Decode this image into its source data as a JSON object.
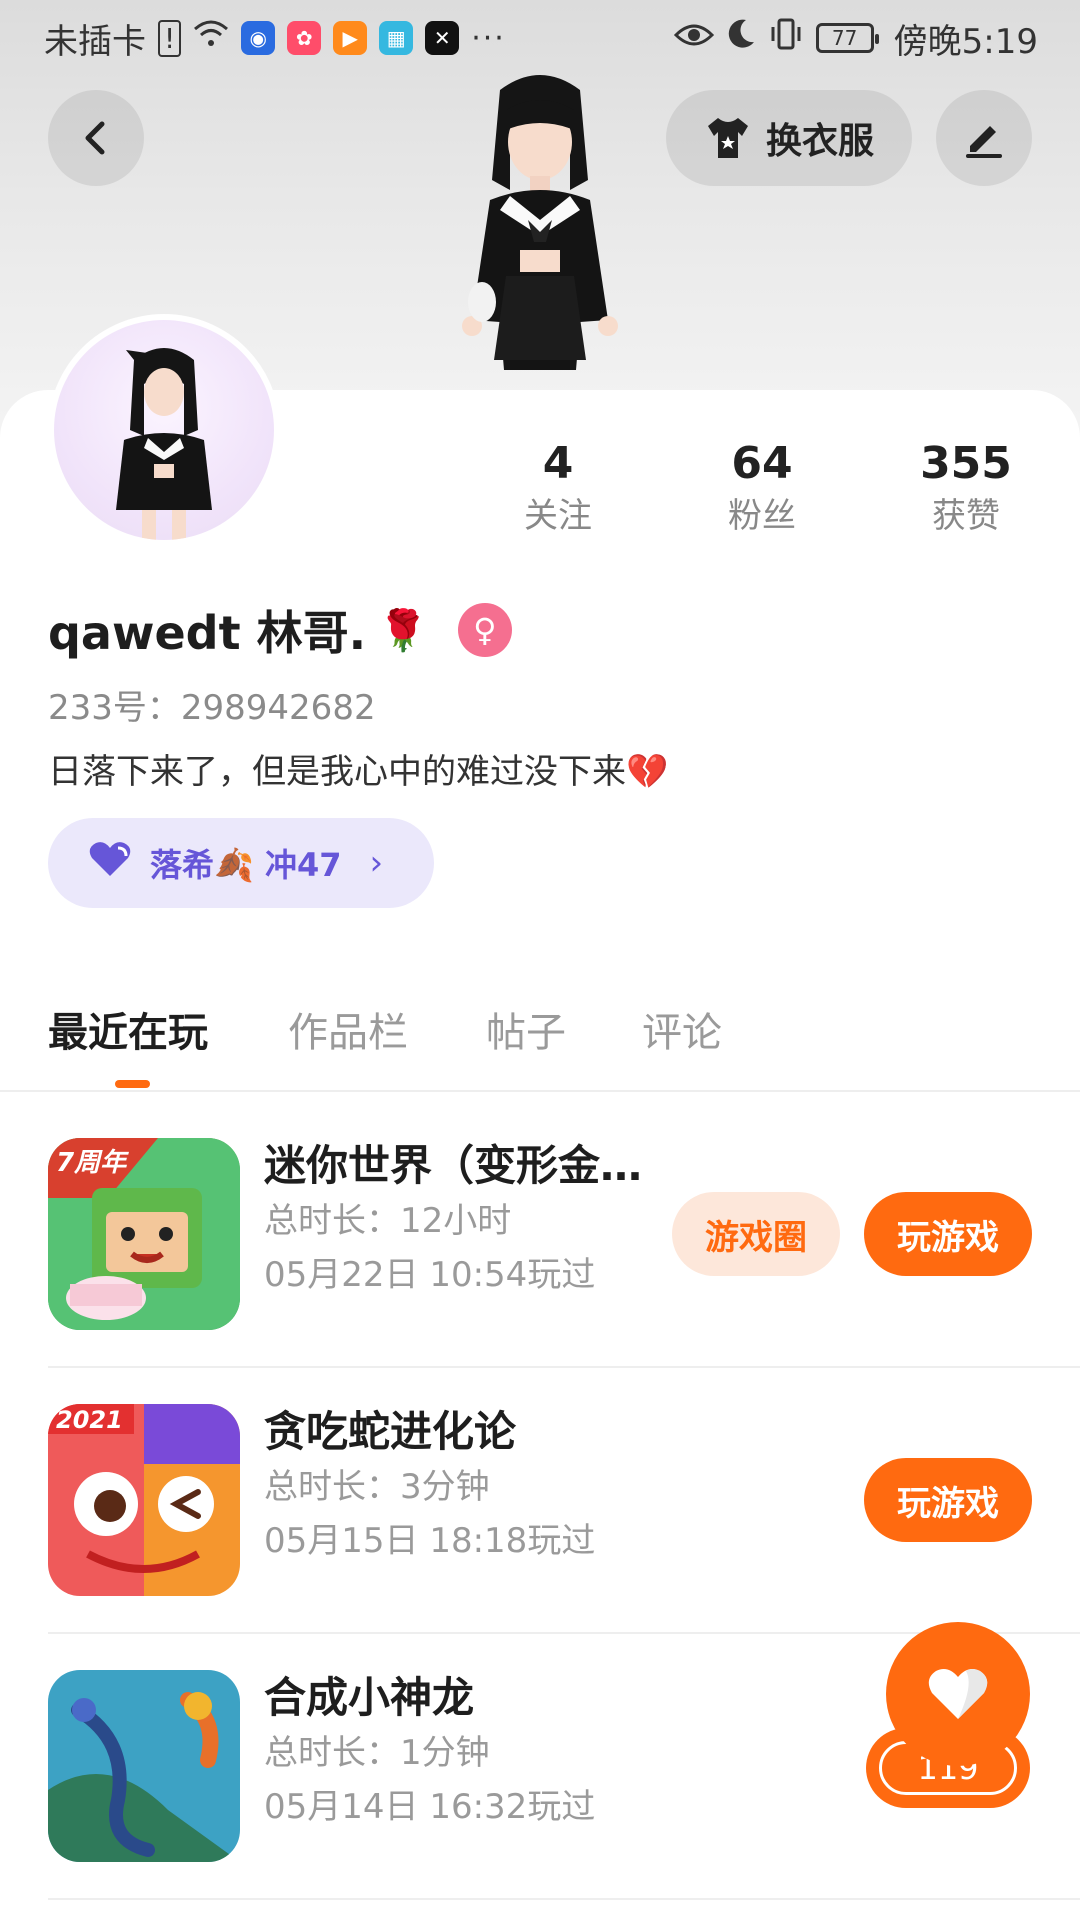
{
  "status_bar": {
    "carrier": "未插卡",
    "more": "···",
    "battery": "77",
    "time": "傍晚5:19"
  },
  "header": {
    "dress_up_label": "换衣服"
  },
  "profile": {
    "username": "qawedt 林哥.",
    "rose_emoji": "🌹",
    "gender_symbol": "♀",
    "user_id": "233号：298942682",
    "bio": "日落下来了，但是我心中的难过没下来",
    "bio_emoji": "💔",
    "guild_tag": "落希🍂 冲47",
    "guild_chevron": "›"
  },
  "stats": [
    {
      "value": "4",
      "label": "关注"
    },
    {
      "value": "64",
      "label": "粉丝"
    },
    {
      "value": "355",
      "label": "获赞"
    }
  ],
  "tabs": [
    {
      "label": "最近在玩"
    },
    {
      "label": "作品栏"
    },
    {
      "label": "帖子"
    },
    {
      "label": "评论"
    }
  ],
  "games": [
    {
      "title": "迷你世界（变形金…",
      "duration": "总时长：12小时",
      "last_played": "05月22日 10:54玩过",
      "circle_label": "游戏圈",
      "play_label": "玩游戏",
      "badge": "7周年"
    },
    {
      "title": "贪吃蛇进化论",
      "duration": "总时长：3分钟",
      "last_played": "05月15日 18:18玩过",
      "play_label": "玩游戏",
      "badge": "2021"
    },
    {
      "title": "合成小神龙",
      "duration": "总时长：1分钟",
      "last_played": "05月14日 16:32玩过"
    }
  ],
  "like": {
    "count": "119"
  },
  "colors": {
    "accent": "#ff6a10",
    "guild": "#6656d8",
    "gender": "#f56f90"
  }
}
